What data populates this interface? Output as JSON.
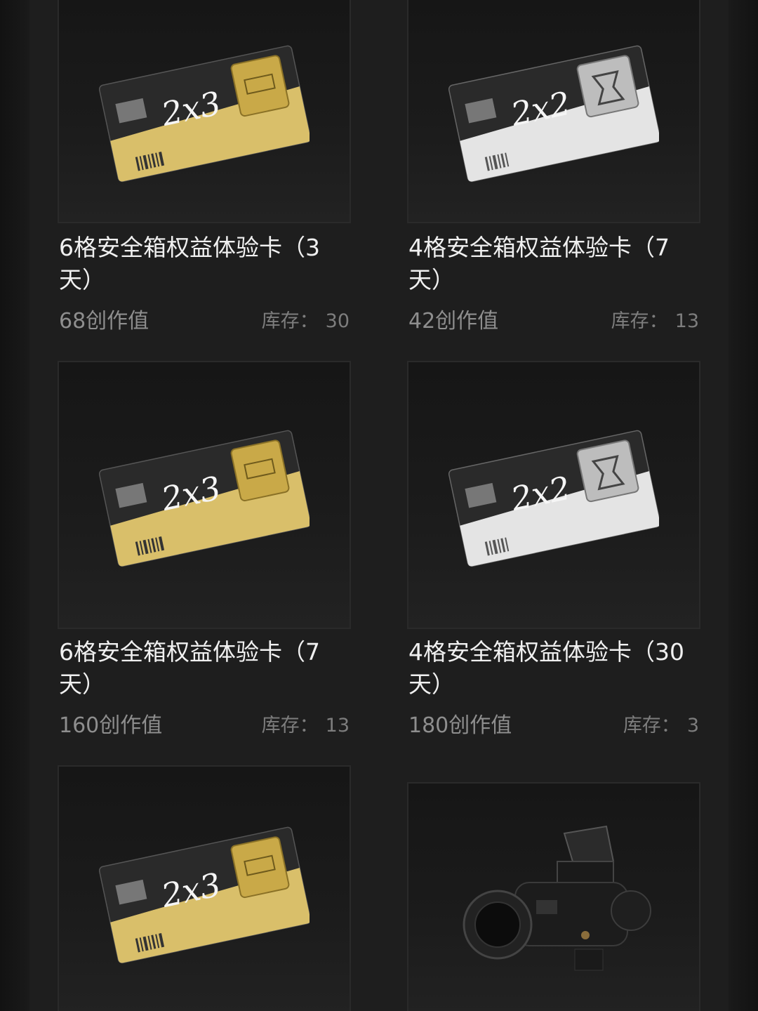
{
  "items": [
    {
      "title": "6格安全箱权益体验卡（3天）",
      "price": "68创作值",
      "stock_label": "库存：",
      "stock": "30",
      "image_icon": "gold-safebox-card-icon",
      "card_text": "2x3"
    },
    {
      "title": "4格安全箱权益体验卡（7天）",
      "price": "42创作值",
      "stock_label": "库存：",
      "stock": "13",
      "image_icon": "silver-safebox-card-icon",
      "card_text": "2x2"
    },
    {
      "title": "6格安全箱权益体验卡（7天）",
      "price": "160创作值",
      "stock_label": "库存：",
      "stock": "13",
      "image_icon": "gold-safebox-card-icon",
      "card_text": "2x3"
    },
    {
      "title": "4格安全箱权益体验卡（30天）",
      "price": "180创作值",
      "stock_label": "库存：",
      "stock": "3",
      "image_icon": "silver-safebox-card-icon",
      "card_text": "2x2"
    },
    {
      "image_icon": "gold-safebox-card-icon",
      "card_text": "2x3"
    },
    {
      "image_icon": "night-vision-goggles-icon"
    }
  ],
  "colors": {
    "background": "#1e1e1e",
    "title": "#f0f0f0",
    "price": "#8e8e8e",
    "gold": "#d9bf6a",
    "silver": "#e4e4e4"
  }
}
